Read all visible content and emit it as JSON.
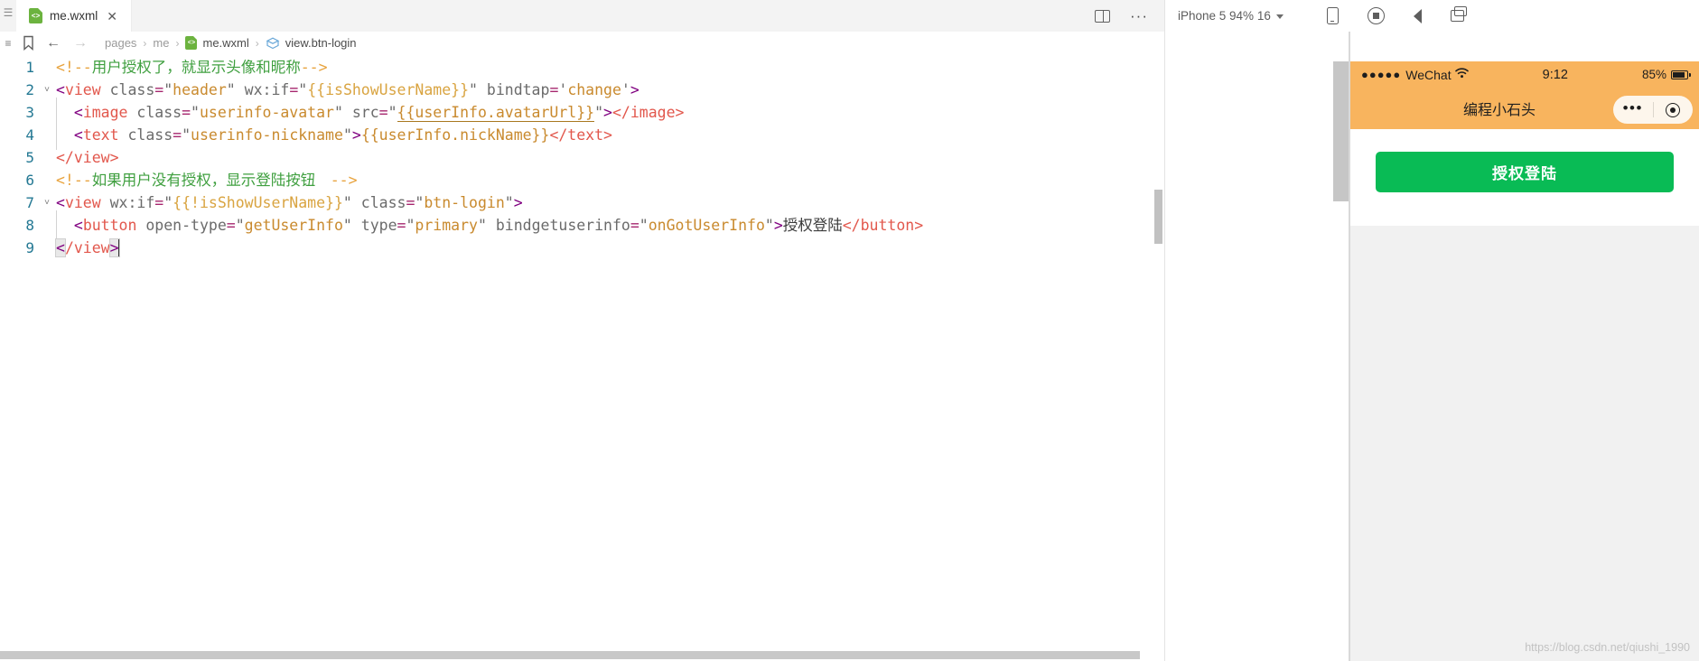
{
  "editor": {
    "tab": {
      "label": "me.wxml",
      "icon": "wxml-file-icon",
      "icon_text": "<>",
      "close": "✕"
    },
    "tabbar_actions": {
      "split_editor": "split-editor-icon",
      "more": "···"
    },
    "rail": {
      "menu": "☰",
      "list": "≡"
    },
    "breadcrumb": {
      "bookmark_icon": "bookmark-icon",
      "back_arrow": "←",
      "forward_arrow": "→",
      "items": [
        {
          "label": "pages",
          "icon": null
        },
        {
          "label": "me",
          "icon": null
        },
        {
          "label": "me.wxml",
          "icon": "wxml-file-icon"
        },
        {
          "label": "view.btn-login",
          "icon": "symbol-cube-icon"
        }
      ],
      "separator": "›"
    },
    "lines": [
      {
        "num": 1,
        "foldable": false
      },
      {
        "num": 2,
        "foldable": true
      },
      {
        "num": 3,
        "foldable": false
      },
      {
        "num": 4,
        "foldable": false
      },
      {
        "num": 5,
        "foldable": false
      },
      {
        "num": 6,
        "foldable": false
      },
      {
        "num": 7,
        "foldable": true
      },
      {
        "num": 8,
        "foldable": false
      },
      {
        "num": 9,
        "foldable": false
      }
    ],
    "code": {
      "l1": {
        "comment_open": "<!--",
        "comment_text": "用户授权了，就显示头像和昵称",
        "comment_close": "-->"
      },
      "l2": {
        "lt": "<",
        "tag": "view",
        "attr1": "class",
        "eq": "=",
        "q": "\"",
        "val1": "header",
        "attr2": "wx:if",
        "val2": "{{isShowUserName}}",
        "attr3": "bindtap",
        "sq": "'",
        "val3": "change",
        "gt": ">"
      },
      "l3": {
        "lt": "<",
        "tag": "image",
        "attr1": "class",
        "val1": "userinfo-avatar",
        "attr2": "src",
        "val2": "{{userInfo.avatarUrl}}",
        "gt": ">",
        "close": "</image>"
      },
      "l4": {
        "lt": "<",
        "tag": "text",
        "attr1": "class",
        "val1": "userinfo-nickname",
        "gt": ">",
        "expr": "{{userInfo.nickName}}",
        "close": "</text>"
      },
      "l5": {
        "close": "</view>"
      },
      "l6": {
        "comment_open": "<!--",
        "comment_text": "如果用户没有授权，显示登陆按钮　",
        "comment_close": "-->"
      },
      "l7": {
        "lt": "<",
        "tag": "view",
        "attr1": "wx:if",
        "val1": "{{!isShowUserName}}",
        "attr2": "class",
        "val2": "btn-login",
        "gt": ">"
      },
      "l8": {
        "lt": "<",
        "tag": "button",
        "attr1": "open-type",
        "val1": "getUserInfo",
        "attr2": "type",
        "val2": "primary",
        "attr3": "bindgetuserinfo",
        "val3": "onGotUserInfo",
        "gt": ">",
        "text": "授权登陆",
        "close": "</button>"
      },
      "l9": {
        "lt": "<",
        "body": "/view",
        "gt": ">"
      }
    }
  },
  "simulator": {
    "toolbar": {
      "device_label": "iPhone 5  94%  16",
      "icons": {
        "device": "phone-icon",
        "record": "record-icon",
        "sound": "sound-icon",
        "window": "detach-window-icon"
      }
    },
    "status_bar": {
      "signal_dots": "●●●●●",
      "carrier": "WeChat",
      "wifi": "📶",
      "time": "9:12",
      "battery_percent": "85%"
    },
    "nav_bar": {
      "title": "编程小石头",
      "capsule_more": "•••",
      "capsule_target": "target-icon"
    },
    "page": {
      "login_button_label": "授权登陆"
    }
  },
  "watermark": "https://blog.csdn.net/qiushi_1990",
  "colors": {
    "wechat_green": "#09bb55",
    "nav_orange": "#f8b45e",
    "tab_active_bg": "#ffffff",
    "gutter_blue": "#237893"
  }
}
